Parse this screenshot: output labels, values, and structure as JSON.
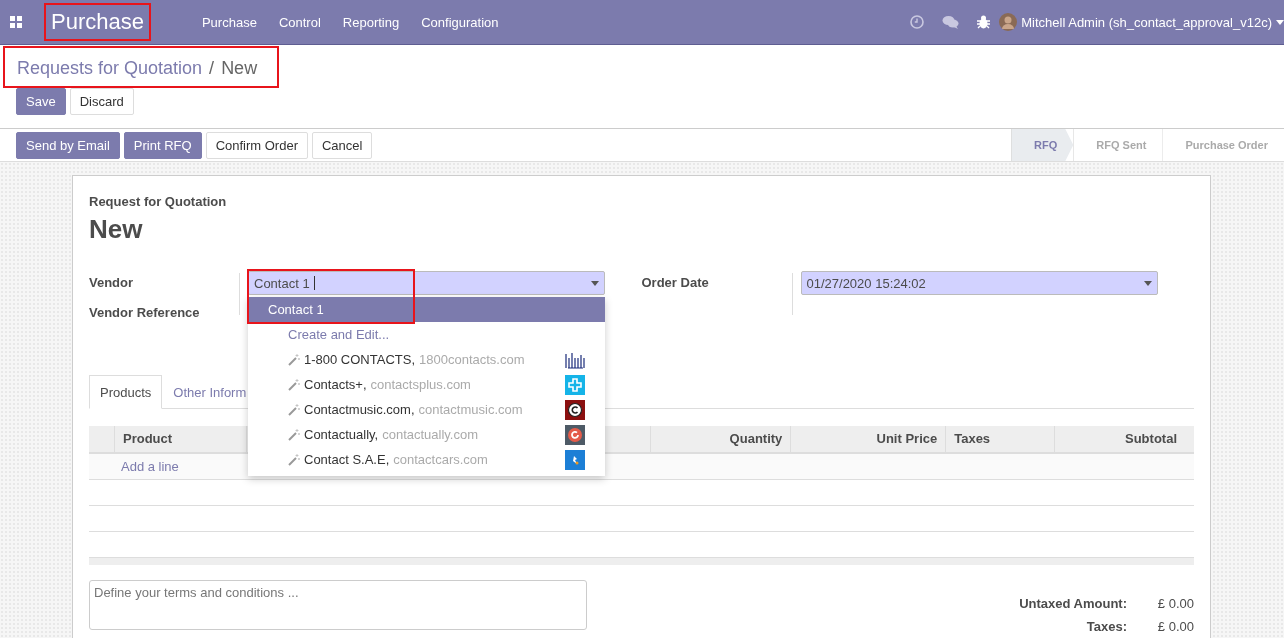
{
  "navbar": {
    "app_title": "Purchase",
    "app_title_highlighted": true,
    "menu": [
      "Purchase",
      "Control",
      "Reporting",
      "Configuration"
    ],
    "user": "Mitchell Admin (sh_contact_approval_v12c)"
  },
  "breadcrumbs": {
    "items": [
      "Requests for Quotation",
      "New"
    ],
    "separator": "/",
    "highlighted": true
  },
  "edit_buttons": [
    {
      "label": "Save",
      "primary": true
    },
    {
      "label": "Discard",
      "primary": false
    }
  ],
  "action_buttons": [
    {
      "label": "Send by Email",
      "primary": true
    },
    {
      "label": "Print RFQ",
      "primary": true
    },
    {
      "label": "Confirm Order",
      "primary": false
    },
    {
      "label": "Cancel",
      "primary": false
    }
  ],
  "statusbar": [
    {
      "label": "RFQ",
      "selected": true
    },
    {
      "label": "RFQ Sent",
      "selected": false
    },
    {
      "label": "Purchase Order",
      "selected": false
    }
  ],
  "form": {
    "subtitle": "Request for Quotation",
    "title": "New",
    "left_fields": [
      {
        "label": "Vendor",
        "value": "Contact 1",
        "highlighted": true
      },
      {
        "label": "Vendor Reference"
      }
    ],
    "right_fields": [
      {
        "label": "Order Date",
        "value": "01/27/2020 15:24:02"
      }
    ],
    "tabs": [
      {
        "label": "Products",
        "selected": true
      },
      {
        "label": "Other Inform",
        "selected": false
      }
    ],
    "table": {
      "columns": [
        "Product",
        "Quantity",
        "Unit Price",
        "Taxes",
        "Subtotal"
      ],
      "add_line": "Add a line"
    },
    "terms": {
      "placeholder": "Define your terms and conditions ..."
    },
    "totals": [
      {
        "label": "Untaxed Amount:",
        "value": "£ 0.00"
      },
      {
        "label": "Taxes:",
        "value": "£ 0.00"
      }
    ]
  },
  "dropdown": {
    "items": [
      {
        "kind": "match",
        "label": "Contact 1",
        "selected": true
      },
      {
        "kind": "create",
        "label": "Create and Edit...",
        "selected": false
      },
      {
        "kind": "suggestion",
        "label": "1-800 CONTACTS,",
        "domain": "1800contacts.com",
        "selected": false
      },
      {
        "kind": "suggestion",
        "label": "Contacts+,",
        "domain": "contactsplus.com",
        "selected": false
      },
      {
        "kind": "suggestion",
        "label": "Contactmusic.com,",
        "domain": "contactmusic.com",
        "selected": false
      },
      {
        "kind": "suggestion",
        "label": "Contactually,",
        "domain": "contactually.com",
        "selected": false
      },
      {
        "kind": "suggestion",
        "label": "Contact S.A.E,",
        "domain": "contactcars.com",
        "selected": false
      }
    ]
  }
}
